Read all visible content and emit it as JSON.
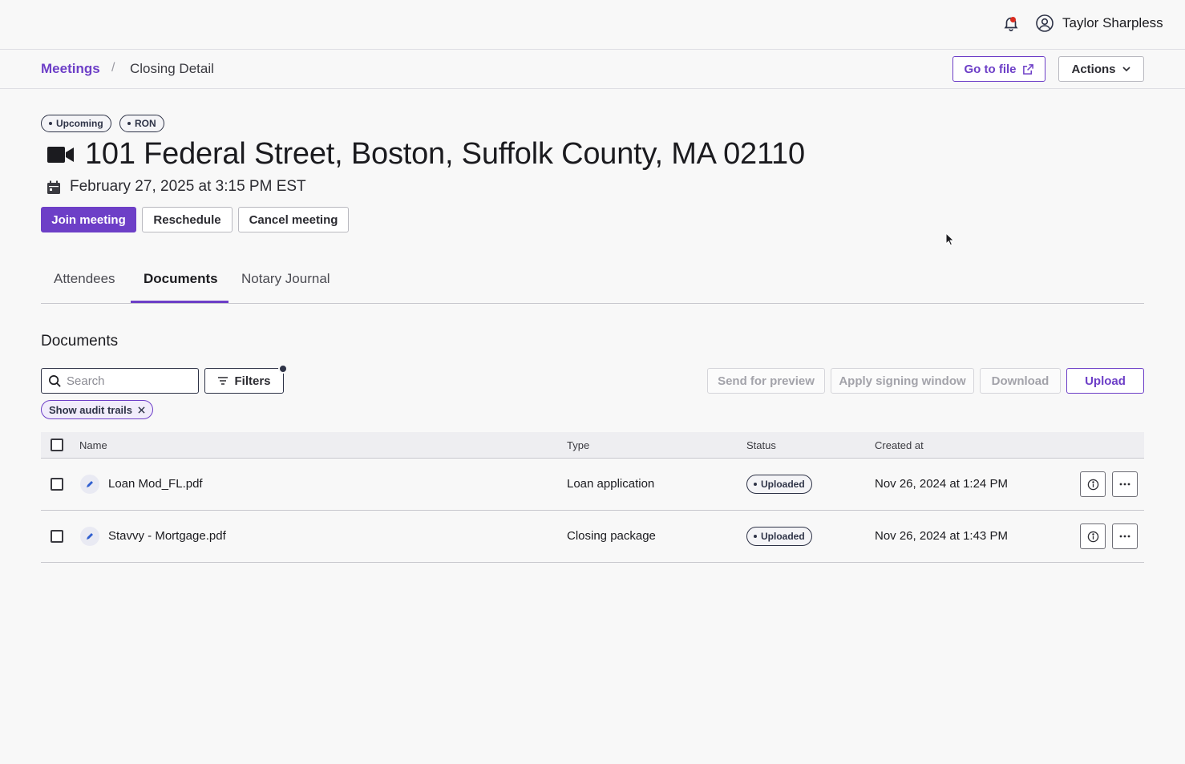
{
  "colors": {
    "accent": "#6d3fc7",
    "text": "#1b1b1f",
    "notification": "#d92c20"
  },
  "header": {
    "user_name": "Taylor Sharpless",
    "icons": [
      "bell-icon",
      "user-circle-icon"
    ]
  },
  "breadcrumb": {
    "parent": "Meetings",
    "separator": "/",
    "current": "Closing Detail"
  },
  "top_actions": {
    "go_to_file": "Go to file",
    "actions": "Actions"
  },
  "meeting": {
    "badges": [
      "Upcoming",
      "RON"
    ],
    "title": "101 Federal Street, Boston, Suffolk County, MA 02110",
    "datetime": "February 27, 2025 at 3:15 PM EST",
    "buttons": {
      "join": "Join meeting",
      "reschedule": "Reschedule",
      "cancel": "Cancel meeting"
    }
  },
  "tabs": [
    {
      "label": "Attendees",
      "active": false
    },
    {
      "label": "Documents",
      "active": true
    },
    {
      "label": "Notary Journal",
      "active": false
    }
  ],
  "documents": {
    "section_title": "Documents",
    "search_placeholder": "Search",
    "filters_label": "Filters",
    "toolbar": {
      "send_preview": "Send for preview",
      "apply_window": "Apply signing window",
      "download": "Download",
      "upload": "Upload"
    },
    "chip": "Show audit trails",
    "columns": {
      "name": "Name",
      "type": "Type",
      "status": "Status",
      "created": "Created at"
    },
    "rows": [
      {
        "name": "Loan Mod_FL.pdf",
        "type": "Loan application",
        "status": "Uploaded",
        "created": "Nov 26, 2024 at 1:24 PM"
      },
      {
        "name": "Stavvy - Mortgage.pdf",
        "type": "Closing package",
        "status": "Uploaded",
        "created": "Nov 26, 2024 at 1:43 PM"
      }
    ]
  }
}
